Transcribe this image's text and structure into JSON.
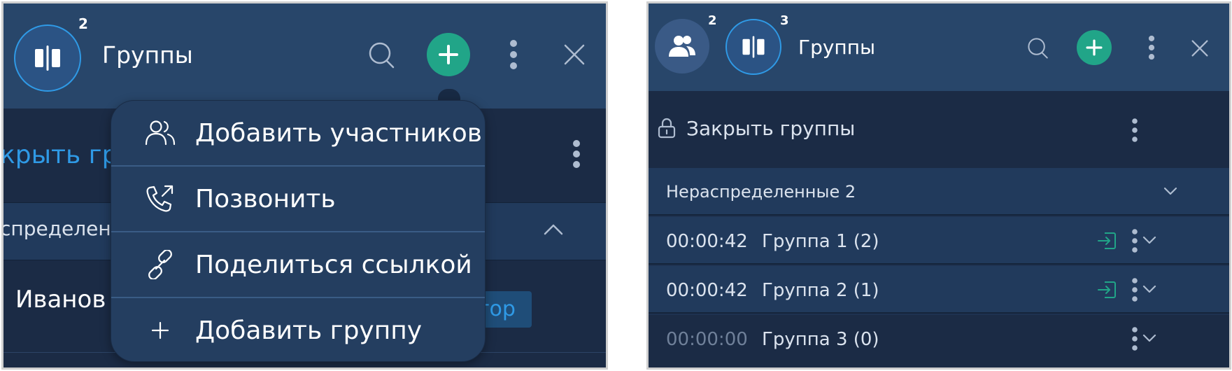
{
  "left_panel": {
    "badge_count": "2",
    "title": "Группы",
    "partial_close_groups": "крыть гр",
    "partial_unassigned": "спределен",
    "partial_participant": "Иванов",
    "partial_role": "тор",
    "menu": {
      "items": [
        {
          "label": "Добавить участников",
          "icon": "users-icon"
        },
        {
          "label": "Позвонить",
          "icon": "phone-outgoing-icon"
        },
        {
          "label": "Поделиться ссылкой",
          "icon": "link-icon"
        },
        {
          "label": "Добавить группу",
          "icon": "plus-icon"
        }
      ]
    }
  },
  "right_panel": {
    "participants_badge": "2",
    "groups_badge": "3",
    "title": "Группы",
    "close_groups_label": "Закрыть группы",
    "unassigned_label": "Нераспределенные 2",
    "groups": [
      {
        "time": "00:00:42",
        "name": "Группа 1 (2)",
        "enter_icon": true,
        "active": true
      },
      {
        "time": "00:00:42",
        "name": "Группа 2 (1)",
        "enter_icon": true,
        "active": true
      },
      {
        "time": "00:00:00",
        "name": "Группа 3 (0)",
        "enter_icon": false,
        "active": false
      }
    ]
  },
  "colors": {
    "accent_green": "#21a588",
    "accent_blue": "#2f9ae6",
    "header_bg": "#28466a",
    "body_bg": "#1b2b45"
  }
}
